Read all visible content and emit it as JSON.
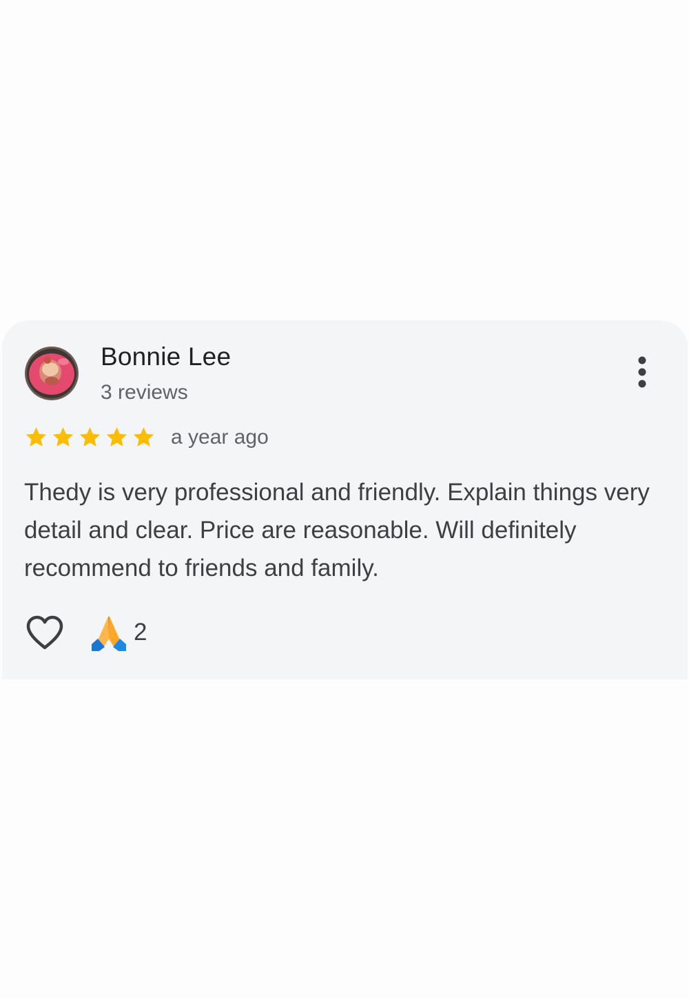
{
  "review": {
    "author_name": "Bonnie Lee",
    "author_reviews": "3 reviews",
    "rating": 5,
    "time_ago": "a year ago",
    "text": "Thedy is very professional and friendly. Explain things very detail and clear. Price are reasonable. Will definitely recommend to friends and family.",
    "reaction_count": "2"
  },
  "icons": {
    "avatar": "avatar-photo",
    "menu": "more-vert-icon",
    "star": "star-icon",
    "like": "heart-icon",
    "reaction": "folded-hands-icon"
  },
  "colors": {
    "card_background": "#f4f5f6",
    "star": "#fbbc04",
    "primary_text": "#202124",
    "secondary_text": "#5f6368"
  }
}
